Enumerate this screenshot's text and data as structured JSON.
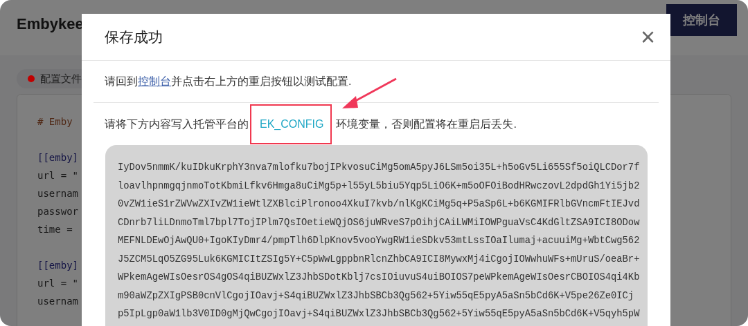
{
  "page": {
    "app_title": "Embykee",
    "console_button": "控制台",
    "tab": {
      "label": "配置文件",
      "color": "#c00000"
    },
    "code_lines": [
      {
        "kind": "comment",
        "text": "# Emby"
      },
      {
        "kind": "blank"
      },
      {
        "kind": "section",
        "text": "[[emby]"
      },
      {
        "kind": "plain",
        "text": "url = \""
      },
      {
        "kind": "plain",
        "text": "usernam"
      },
      {
        "kind": "plain",
        "text": "passwor"
      },
      {
        "kind": "plain",
        "text": "time ="
      },
      {
        "kind": "blank"
      },
      {
        "kind": "section",
        "text": "[[emby]"
      },
      {
        "kind": "plain",
        "text": "url = \""
      },
      {
        "kind": "plain",
        "text": "usernam"
      }
    ]
  },
  "dialog": {
    "title": "保存成功",
    "close": "×",
    "instruction": {
      "before": "请回到",
      "link": "控制台",
      "after": "并点击右上方的重启按钮以测试配置."
    },
    "env_note": {
      "before": "请将下方内容写入托管平台的",
      "variable": "EK_CONFIG",
      "after": "环境变量，否则配置将在重启后丢失."
    },
    "config_lines": [
      "IyDov5nmmK/kuIDkuKrphY3nva7mlofku7bojIPkvosuCiMg5omA5pyJ6LSm5oi35L+h5oGv5Li655Sf5oiQLCDor7f",
      "loavlhpnmgqjnmoTotKbmiLfkv6Hmga8uCiMg5p+l55yL5biu5Yqp5LiO6K+m5oOFOiBodHRwczovL2dpdGh1Yi5jb2",
      "0vZW1ieS1rZWVwZXIvZW1ieWtlZXBlciPlronoo4XkuI7kvb/nlKgKCiMg5q+P5aSp6L+b6KGMIFRlbGVncmFtIEJvd",
      "CDnrb7liLDnmoTml7bpl7TojIPlm7QsIOetieWQjOS6juWRveS7pOihjCAiLWMiIOWPguaVsC4KdGltZSA9ICI8ODow",
      "MEFNLDEwOjAwQU0+IgoKIyDmr4/pmpTlh6DlpKnov5vooYwgRW1ieSDkv53mtLssIOaIlumaj+acuuiMg+WbtCwg562",
      "J5ZCM5LqO5ZG95Luk6KGMICItZSIg5Y+C5pWwLgppbnRlcnZhbCA9ICI8MywxMj4iCgojIOWwhuWFs+mUruS/oeaBr+",
      "WPkemAgeWIsOesrOS4gOS4qiBUZWxlZ3JhbSDotKblj7csIOiuvuS4uiBOIOS7peWPkemAgeWIsOesrCBOIOS4qi4Kb",
      "m90aWZpZXIgPSB0cnVlCgojIOavj+S4qiBUZWxlZ3JhbSBCb3Qg562+5Yiw55qE5pyA5aSn5bCd6K+V5pe26Ze0ICj",
      "p5IpLgp0aW1lb3V0ID0gMjQwCgojIOavj+S4qiBUZWxlZ3JhbSBCb3Qg562+5Yiw55qE5pyA5aSn5bCd6K+V5qyh5pW"
    ]
  }
}
